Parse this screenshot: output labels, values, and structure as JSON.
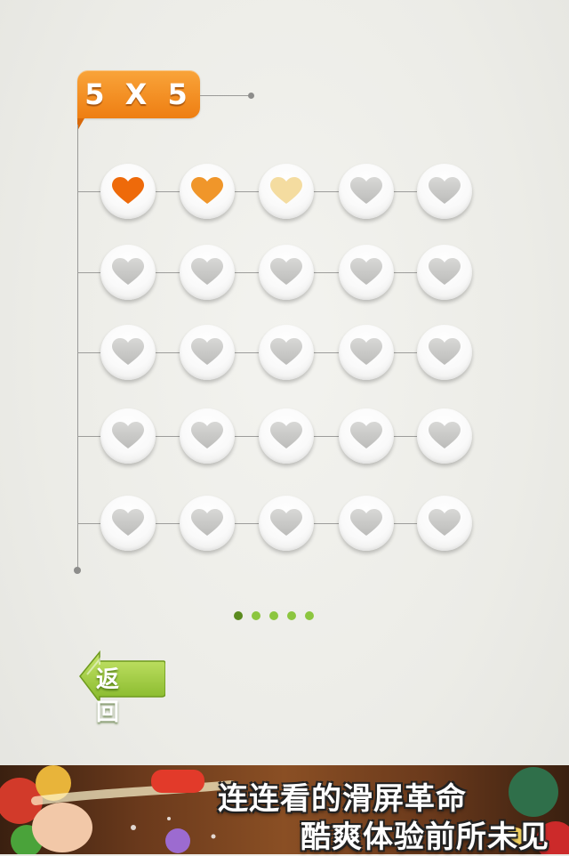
{
  "level": {
    "title": "5 X 5",
    "rows": 5,
    "cols": 5
  },
  "hearts": [
    [
      "orange",
      "orange-light",
      "pale",
      "empty",
      "empty"
    ],
    [
      "empty",
      "empty",
      "empty",
      "empty",
      "empty"
    ],
    [
      "empty",
      "empty",
      "empty",
      "empty",
      "empty"
    ],
    [
      "empty",
      "empty",
      "empty",
      "empty",
      "empty"
    ],
    [
      "empty",
      "empty",
      "empty",
      "empty",
      "empty"
    ]
  ],
  "heart_colors": {
    "orange": "#ee6a0a",
    "orange-light": "#f0962a",
    "pale": "#f4dca0",
    "empty": "#c9c9c7"
  },
  "pager": {
    "pages": 5,
    "current": 1
  },
  "back_button": {
    "label": "返 回",
    "icon": "left-arrow-icon",
    "color": "#9acb3c"
  },
  "ad_banner": {
    "line1": "连连看的滑屏革命",
    "line2": "酷爽体验前所未见"
  }
}
